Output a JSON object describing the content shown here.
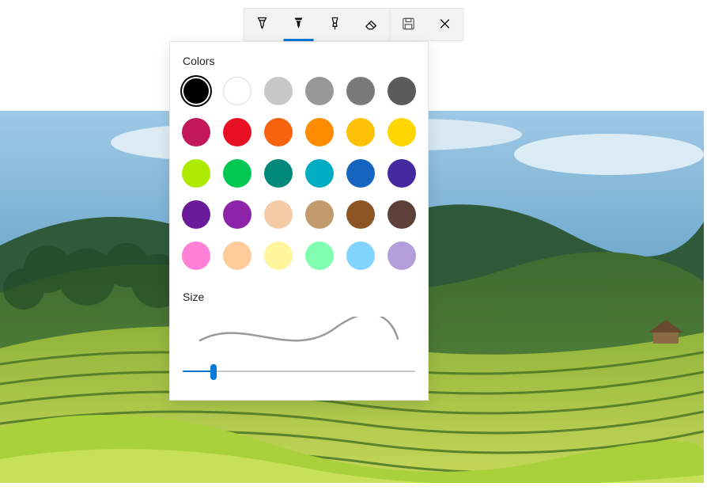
{
  "toolbar": {
    "tools": [
      {
        "id": "ballpoint-pen",
        "kind": "pen-outline",
        "active": false
      },
      {
        "id": "pencil",
        "kind": "pen-solid",
        "active": true
      },
      {
        "id": "highlighter",
        "kind": "highlighter",
        "active": false
      },
      {
        "id": "eraser",
        "kind": "eraser",
        "active": false
      }
    ],
    "actions": [
      {
        "id": "save",
        "kind": "save"
      },
      {
        "id": "close",
        "kind": "close"
      }
    ]
  },
  "panel": {
    "colors_label": "Colors",
    "size_label": "Size",
    "selected_color_index": 0,
    "colors": [
      {
        "name": "black",
        "hex": "#000000"
      },
      {
        "name": "white",
        "hex": "#ffffff"
      },
      {
        "name": "light-gray",
        "hex": "#c7c7c7"
      },
      {
        "name": "gray",
        "hex": "#989898"
      },
      {
        "name": "dim-gray",
        "hex": "#7a7a7a"
      },
      {
        "name": "dark-gray",
        "hex": "#5b5b5b"
      },
      {
        "name": "magenta-dark",
        "hex": "#c2185b"
      },
      {
        "name": "red",
        "hex": "#e81123"
      },
      {
        "name": "orange",
        "hex": "#f7630c"
      },
      {
        "name": "amber",
        "hex": "#ff8c00"
      },
      {
        "name": "gold",
        "hex": "#ffc107"
      },
      {
        "name": "yellow",
        "hex": "#ffd600"
      },
      {
        "name": "lime",
        "hex": "#aeea00"
      },
      {
        "name": "green",
        "hex": "#00c853"
      },
      {
        "name": "teal",
        "hex": "#00897b"
      },
      {
        "name": "cyan",
        "hex": "#00acc1"
      },
      {
        "name": "blue",
        "hex": "#1565c0"
      },
      {
        "name": "indigo",
        "hex": "#4527a0"
      },
      {
        "name": "purple",
        "hex": "#6a1b9a"
      },
      {
        "name": "violet",
        "hex": "#8e24aa"
      },
      {
        "name": "skin",
        "hex": "#f5cba7"
      },
      {
        "name": "tan",
        "hex": "#c19a6b"
      },
      {
        "name": "brown",
        "hex": "#8d5524"
      },
      {
        "name": "dark-brown",
        "hex": "#5d4037"
      },
      {
        "name": "pink-light",
        "hex": "#ff80d4"
      },
      {
        "name": "peach",
        "hex": "#ffcc99"
      },
      {
        "name": "pale-yellow",
        "hex": "#fff59d"
      },
      {
        "name": "mint",
        "hex": "#80ffb0"
      },
      {
        "name": "sky",
        "hex": "#80d4ff"
      },
      {
        "name": "lavender",
        "hex": "#b39ddb"
      }
    ],
    "size": {
      "min": 1,
      "max": 100,
      "value": 14
    }
  },
  "image": {
    "description": "landscape-photo-rice-terraces"
  }
}
